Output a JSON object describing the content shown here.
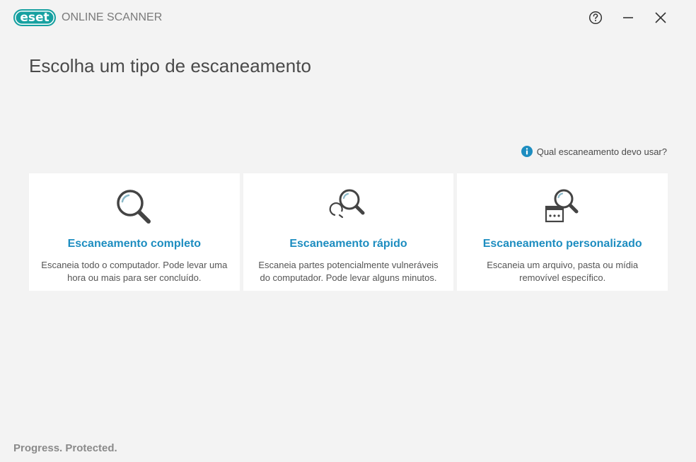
{
  "app": {
    "logo_text": "eset",
    "product_name": "ONLINE SCANNER"
  },
  "window_controls": {
    "help_icon": "help-circle-icon",
    "minimize_icon": "minimize-icon",
    "close_icon": "close-icon"
  },
  "main": {
    "title": "Escolha um tipo de escaneamento",
    "help_link": "Qual escaneamento devo usar?",
    "cards": [
      {
        "icon": "magnifier-icon",
        "title": "Escaneamento completo",
        "description": "Escaneia todo o computador. Pode levar uma hora ou mais para ser concluído."
      },
      {
        "icon": "magnifier-clock-icon",
        "title": "Escaneamento rápido",
        "description": "Escaneia partes potencialmente vulneráveis do computador. Pode levar alguns minutos."
      },
      {
        "icon": "magnifier-window-icon",
        "title": "Escaneamento personalizado",
        "description": "Escaneia um arquivo, pasta ou mídia removível específico."
      }
    ]
  },
  "footer": {
    "slogan": "Progress. Protected."
  },
  "colors": {
    "brand_teal": "#16a0a0",
    "link_blue": "#1d8dc0",
    "background": "#f3f3f3",
    "card_background": "#ffffff"
  }
}
